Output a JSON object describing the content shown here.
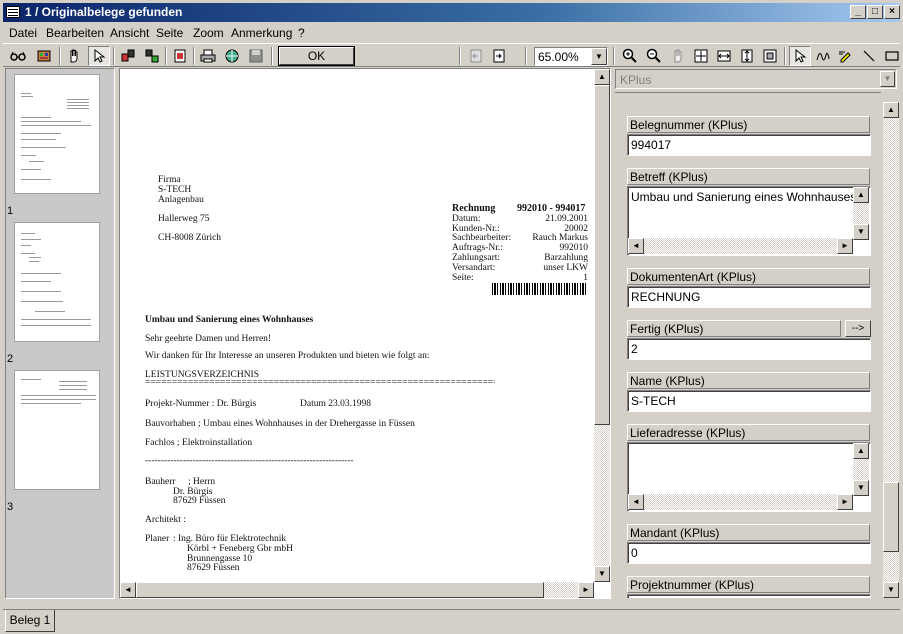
{
  "window": {
    "title": "1 / Originalbelege gefunden",
    "min": "_",
    "max": "□",
    "close": "×"
  },
  "menu": [
    "Datei",
    "Bearbeiten",
    "Ansicht",
    "Seite",
    "Zoom",
    "Anmerkung",
    "?"
  ],
  "toolbar": {
    "ok_label": "OK",
    "zoom_value": "65.00%"
  },
  "thumbnails": {
    "pages": [
      "1",
      "2",
      "3"
    ]
  },
  "document": {
    "company": [
      "Firma",
      "S-TECH",
      "Anlagenbau"
    ],
    "street": "Hallerweg 75",
    "city": "CH-8008 Zürich",
    "invoice_label": "Rechnung",
    "invoice_range": "992010 - 994017",
    "meta": [
      {
        "k": "Datum:",
        "v": "21.09.2001"
      },
      {
        "k": "Kunden-Nr.:",
        "v": "20002"
      },
      {
        "k": "Sachbearbeiter:",
        "v": "Rauch Markus"
      },
      {
        "k": "Auftrags-Nr.:",
        "v": "992010"
      },
      {
        "k": "Zahlungsart:",
        "v": "Barzahlung"
      },
      {
        "k": "Versandart:",
        "v": "unser LKW"
      },
      {
        "k": "Seite:",
        "v": "1"
      }
    ],
    "subject": "Umbau und Sanierung eines Wohnhauses",
    "greeting": "Sehr geehrte Damen und Herren!",
    "intro": "Wir danken für Ihr Interesse an unseren Produkten und bieten wie folgt an:",
    "section": "LEISTUNGSVERZEICHNIS",
    "rule": "==================================================================",
    "projekt": "Projekt-Nummer :   Dr. Bürgis",
    "projekt_date": "Datum 23.03.1998",
    "bauvorhaben": "Bauvorhaben    ;   Umbau eines Wohnhauses in der Drehergasse in Füssen",
    "fachlos": "Fachlos        ;   Elektroinstallation",
    "dash": "-----------------------------------------------------------------------------------------------",
    "bauherr_label": "Bauherr",
    "bauherr": [
      "; Herrn",
      "Dr. Bürgis",
      "87629 Füssen"
    ],
    "architekt": "Architekt       :",
    "planer_label": "Planer",
    "planer": [
      ":   Ing. Büro für Elektrotechnik",
      "Körbl + Feneberg Gbr mbH",
      "Brunnengasse 10",
      "87629 Füssen"
    ]
  },
  "panel": {
    "selector": "KPlus",
    "fields": [
      {
        "label": "Belegnummer (KPlus)",
        "value": "994017",
        "type": "text"
      },
      {
        "label": "Betreff (KPlus)",
        "value": "Umbau und Sanierung eines Wohnhauses",
        "type": "area"
      },
      {
        "label": "DokumentenArt (KPlus)",
        "value": "RECHNUNG",
        "type": "text"
      },
      {
        "label": "Fertig (KPlus)",
        "value": "2",
        "type": "text",
        "button": "-->"
      },
      {
        "label": "Name (KPlus)",
        "value": "S-TECH",
        "type": "text"
      },
      {
        "label": "Lieferadresse (KPlus)",
        "value": "",
        "type": "area"
      },
      {
        "label": "Mandant  (KPlus)",
        "value": "0",
        "type": "text"
      },
      {
        "label": "Projektnummer (KPlus)",
        "value": "",
        "type": "text"
      }
    ]
  },
  "tabs": [
    "Beleg 1"
  ]
}
